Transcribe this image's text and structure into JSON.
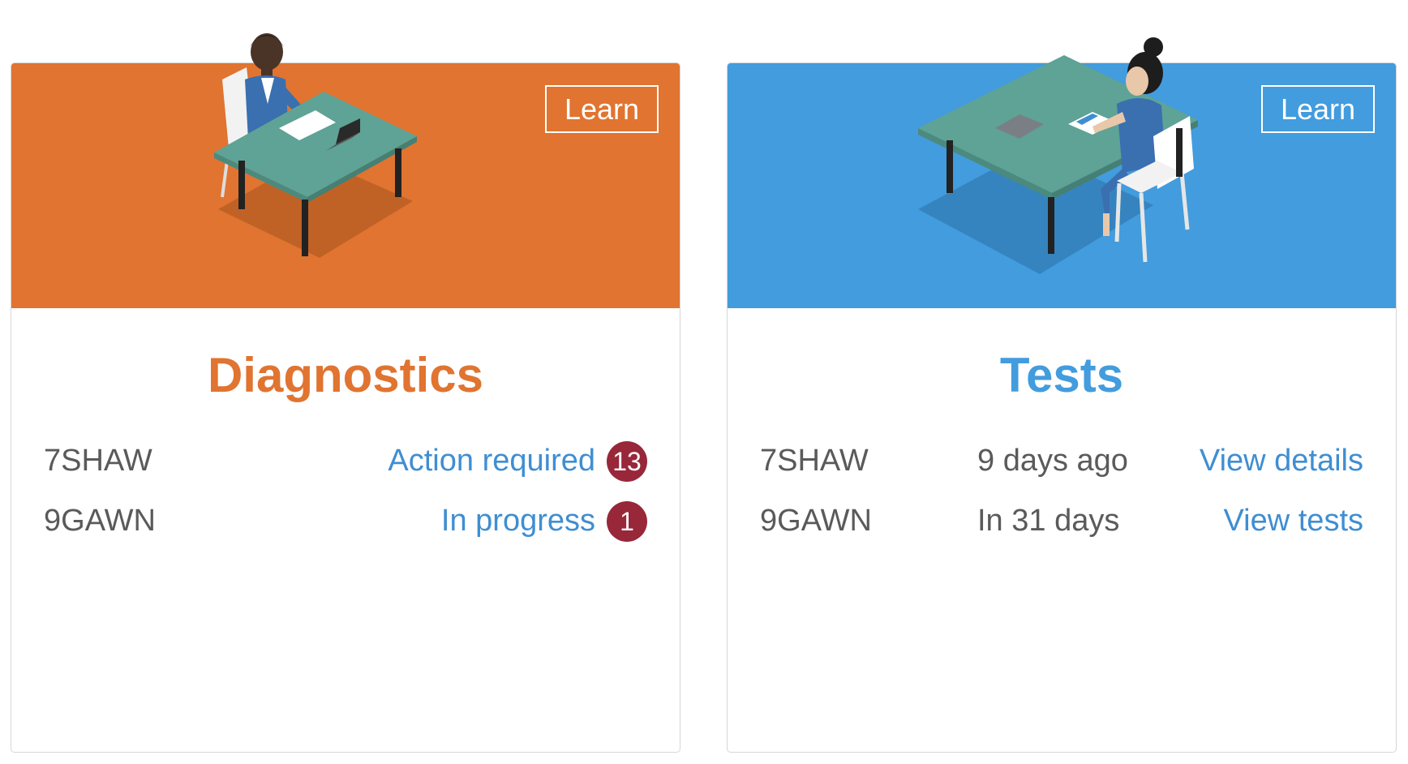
{
  "cards": [
    {
      "title": "Diagnostics",
      "learn_label": "Learn",
      "rows": [
        {
          "code": "7SHAW",
          "status": "Action required",
          "count": "13"
        },
        {
          "code": "9GAWN",
          "status": "In progress",
          "count": "1"
        }
      ]
    },
    {
      "title": "Tests",
      "learn_label": "Learn",
      "rows": [
        {
          "code": "7SHAW",
          "when": "9 days ago",
          "link": "View details"
        },
        {
          "code": "9GAWN",
          "when": "In 31 days",
          "link": "View tests"
        }
      ]
    }
  ],
  "colors": {
    "diagnostics_accent": "#e07430",
    "tests_accent": "#429cdd",
    "link": "#3f8ed2",
    "badge": "#98273a",
    "text": "#5a5a5a"
  },
  "icons": [
    "teacher-at-desk-illustration",
    "student-at-desk-illustration"
  ]
}
